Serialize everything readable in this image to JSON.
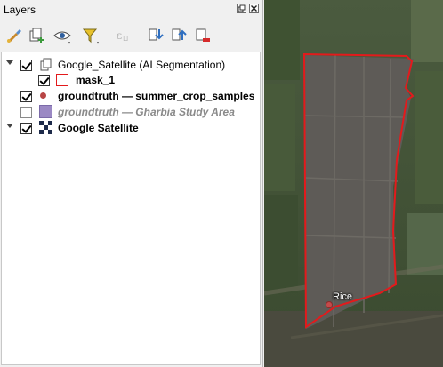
{
  "layers_panel": {
    "title": "Layers"
  },
  "layers": [
    {
      "name": "Google_Satellite (AI Segmentation)"
    },
    {
      "name": "mask_1"
    },
    {
      "name": "groundtruth — summer_crop_samples"
    },
    {
      "name": "groundtruth — Gharbia Study Area"
    },
    {
      "name": "Google Satellite"
    }
  ],
  "map": {
    "point_label": "Rice"
  },
  "colors": {
    "mask_outline": "#e31a1c",
    "sample_point": "#c44a4a",
    "study_area_fill": "#9b89c4"
  }
}
